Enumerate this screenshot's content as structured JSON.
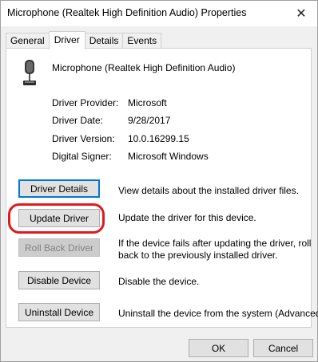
{
  "window": {
    "title": "Microphone (Realtek High Definition Audio) Properties",
    "close_glyph": "✕"
  },
  "tabs": [
    {
      "label": "General",
      "active": false
    },
    {
      "label": "Driver",
      "active": true
    },
    {
      "label": "Details",
      "active": false
    },
    {
      "label": "Events",
      "active": false
    }
  ],
  "device": {
    "icon": "microphone-icon",
    "name": "Microphone (Realtek High Definition Audio)"
  },
  "driver_info": [
    {
      "label": "Driver Provider:",
      "value": "Microsoft"
    },
    {
      "label": "Driver Date:",
      "value": "9/28/2017"
    },
    {
      "label": "Driver Version:",
      "value": "10.0.16299.15"
    },
    {
      "label": "Digital Signer:",
      "value": "Microsoft Windows"
    }
  ],
  "actions": [
    {
      "button": "Driver Details",
      "description": "View details about the installed driver files.",
      "enabled": true,
      "focused": true
    },
    {
      "button": "Update Driver",
      "description": "Update the driver for this device.",
      "enabled": true,
      "highlighted": true
    },
    {
      "button": "Roll Back Driver",
      "description": "If the device fails after updating the driver, roll",
      "description2": "back to the previously installed driver.",
      "enabled": false
    },
    {
      "button": "Disable Device",
      "description": "Disable the device.",
      "enabled": true
    },
    {
      "button": "Uninstall Device",
      "description": "Uninstall the device from the system (Advanced).",
      "enabled": true
    }
  ],
  "footer": {
    "ok_label": "OK",
    "cancel_label": "Cancel"
  },
  "colors": {
    "focus_border": "#0078d7",
    "annotation_red": "#e0191e"
  }
}
